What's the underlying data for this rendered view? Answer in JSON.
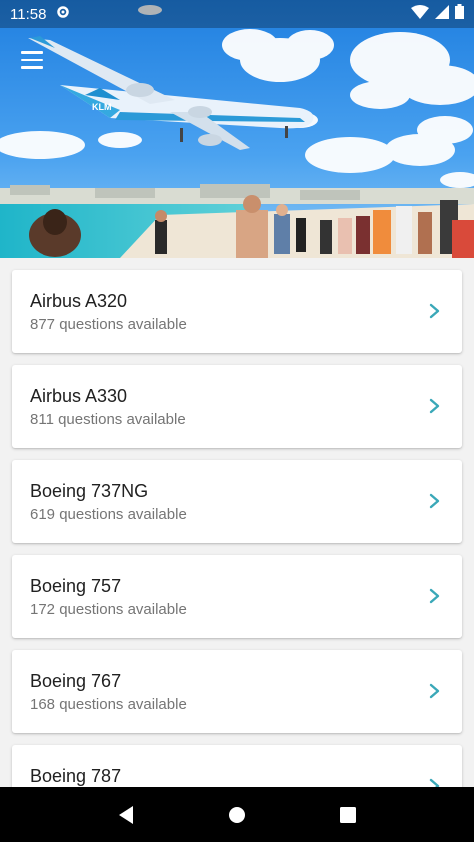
{
  "status_bar": {
    "time": "11:58",
    "icons": [
      "settings-gear-icon",
      "wifi-icon",
      "cell-signal-icon",
      "battery-icon"
    ]
  },
  "header": {
    "image": "klm-plane-over-beach-photo",
    "menu_icon": "hamburger-menu-icon"
  },
  "aircraft_list": [
    {
      "name": "Airbus A320",
      "subtitle": "877 questions available"
    },
    {
      "name": "Airbus A330",
      "subtitle": "811 questions available"
    },
    {
      "name": "Boeing 737NG",
      "subtitle": "619 questions available"
    },
    {
      "name": "Boeing 757",
      "subtitle": "172 questions available"
    },
    {
      "name": "Boeing 767",
      "subtitle": "168 questions available"
    },
    {
      "name": "Boeing 787",
      "subtitle": ""
    }
  ],
  "colors": {
    "accent": "#3aa8b8",
    "card_bg": "#ffffff",
    "page_bg": "#f2f2f2",
    "nav_bg": "#000000"
  },
  "nav_bar": {
    "buttons": [
      "back-icon",
      "home-icon",
      "recents-icon"
    ]
  }
}
